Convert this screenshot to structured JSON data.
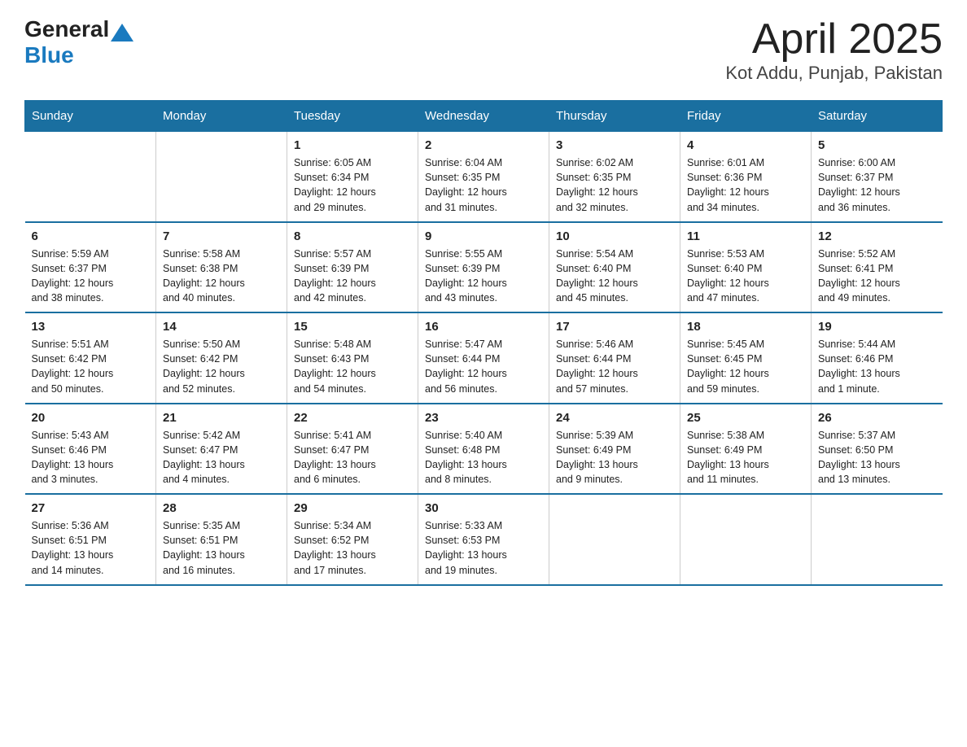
{
  "logo": {
    "general": "General",
    "blue": "Blue"
  },
  "title": "April 2025",
  "subtitle": "Kot Addu, Punjab, Pakistan",
  "days_of_week": [
    "Sunday",
    "Monday",
    "Tuesday",
    "Wednesday",
    "Thursday",
    "Friday",
    "Saturday"
  ],
  "weeks": [
    [
      {
        "day": "",
        "info": ""
      },
      {
        "day": "",
        "info": ""
      },
      {
        "day": "1",
        "info": "Sunrise: 6:05 AM\nSunset: 6:34 PM\nDaylight: 12 hours\nand 29 minutes."
      },
      {
        "day": "2",
        "info": "Sunrise: 6:04 AM\nSunset: 6:35 PM\nDaylight: 12 hours\nand 31 minutes."
      },
      {
        "day": "3",
        "info": "Sunrise: 6:02 AM\nSunset: 6:35 PM\nDaylight: 12 hours\nand 32 minutes."
      },
      {
        "day": "4",
        "info": "Sunrise: 6:01 AM\nSunset: 6:36 PM\nDaylight: 12 hours\nand 34 minutes."
      },
      {
        "day": "5",
        "info": "Sunrise: 6:00 AM\nSunset: 6:37 PM\nDaylight: 12 hours\nand 36 minutes."
      }
    ],
    [
      {
        "day": "6",
        "info": "Sunrise: 5:59 AM\nSunset: 6:37 PM\nDaylight: 12 hours\nand 38 minutes."
      },
      {
        "day": "7",
        "info": "Sunrise: 5:58 AM\nSunset: 6:38 PM\nDaylight: 12 hours\nand 40 minutes."
      },
      {
        "day": "8",
        "info": "Sunrise: 5:57 AM\nSunset: 6:39 PM\nDaylight: 12 hours\nand 42 minutes."
      },
      {
        "day": "9",
        "info": "Sunrise: 5:55 AM\nSunset: 6:39 PM\nDaylight: 12 hours\nand 43 minutes."
      },
      {
        "day": "10",
        "info": "Sunrise: 5:54 AM\nSunset: 6:40 PM\nDaylight: 12 hours\nand 45 minutes."
      },
      {
        "day": "11",
        "info": "Sunrise: 5:53 AM\nSunset: 6:40 PM\nDaylight: 12 hours\nand 47 minutes."
      },
      {
        "day": "12",
        "info": "Sunrise: 5:52 AM\nSunset: 6:41 PM\nDaylight: 12 hours\nand 49 minutes."
      }
    ],
    [
      {
        "day": "13",
        "info": "Sunrise: 5:51 AM\nSunset: 6:42 PM\nDaylight: 12 hours\nand 50 minutes."
      },
      {
        "day": "14",
        "info": "Sunrise: 5:50 AM\nSunset: 6:42 PM\nDaylight: 12 hours\nand 52 minutes."
      },
      {
        "day": "15",
        "info": "Sunrise: 5:48 AM\nSunset: 6:43 PM\nDaylight: 12 hours\nand 54 minutes."
      },
      {
        "day": "16",
        "info": "Sunrise: 5:47 AM\nSunset: 6:44 PM\nDaylight: 12 hours\nand 56 minutes."
      },
      {
        "day": "17",
        "info": "Sunrise: 5:46 AM\nSunset: 6:44 PM\nDaylight: 12 hours\nand 57 minutes."
      },
      {
        "day": "18",
        "info": "Sunrise: 5:45 AM\nSunset: 6:45 PM\nDaylight: 12 hours\nand 59 minutes."
      },
      {
        "day": "19",
        "info": "Sunrise: 5:44 AM\nSunset: 6:46 PM\nDaylight: 13 hours\nand 1 minute."
      }
    ],
    [
      {
        "day": "20",
        "info": "Sunrise: 5:43 AM\nSunset: 6:46 PM\nDaylight: 13 hours\nand 3 minutes."
      },
      {
        "day": "21",
        "info": "Sunrise: 5:42 AM\nSunset: 6:47 PM\nDaylight: 13 hours\nand 4 minutes."
      },
      {
        "day": "22",
        "info": "Sunrise: 5:41 AM\nSunset: 6:47 PM\nDaylight: 13 hours\nand 6 minutes."
      },
      {
        "day": "23",
        "info": "Sunrise: 5:40 AM\nSunset: 6:48 PM\nDaylight: 13 hours\nand 8 minutes."
      },
      {
        "day": "24",
        "info": "Sunrise: 5:39 AM\nSunset: 6:49 PM\nDaylight: 13 hours\nand 9 minutes."
      },
      {
        "day": "25",
        "info": "Sunrise: 5:38 AM\nSunset: 6:49 PM\nDaylight: 13 hours\nand 11 minutes."
      },
      {
        "day": "26",
        "info": "Sunrise: 5:37 AM\nSunset: 6:50 PM\nDaylight: 13 hours\nand 13 minutes."
      }
    ],
    [
      {
        "day": "27",
        "info": "Sunrise: 5:36 AM\nSunset: 6:51 PM\nDaylight: 13 hours\nand 14 minutes."
      },
      {
        "day": "28",
        "info": "Sunrise: 5:35 AM\nSunset: 6:51 PM\nDaylight: 13 hours\nand 16 minutes."
      },
      {
        "day": "29",
        "info": "Sunrise: 5:34 AM\nSunset: 6:52 PM\nDaylight: 13 hours\nand 17 minutes."
      },
      {
        "day": "30",
        "info": "Sunrise: 5:33 AM\nSunset: 6:53 PM\nDaylight: 13 hours\nand 19 minutes."
      },
      {
        "day": "",
        "info": ""
      },
      {
        "day": "",
        "info": ""
      },
      {
        "day": "",
        "info": ""
      }
    ]
  ]
}
